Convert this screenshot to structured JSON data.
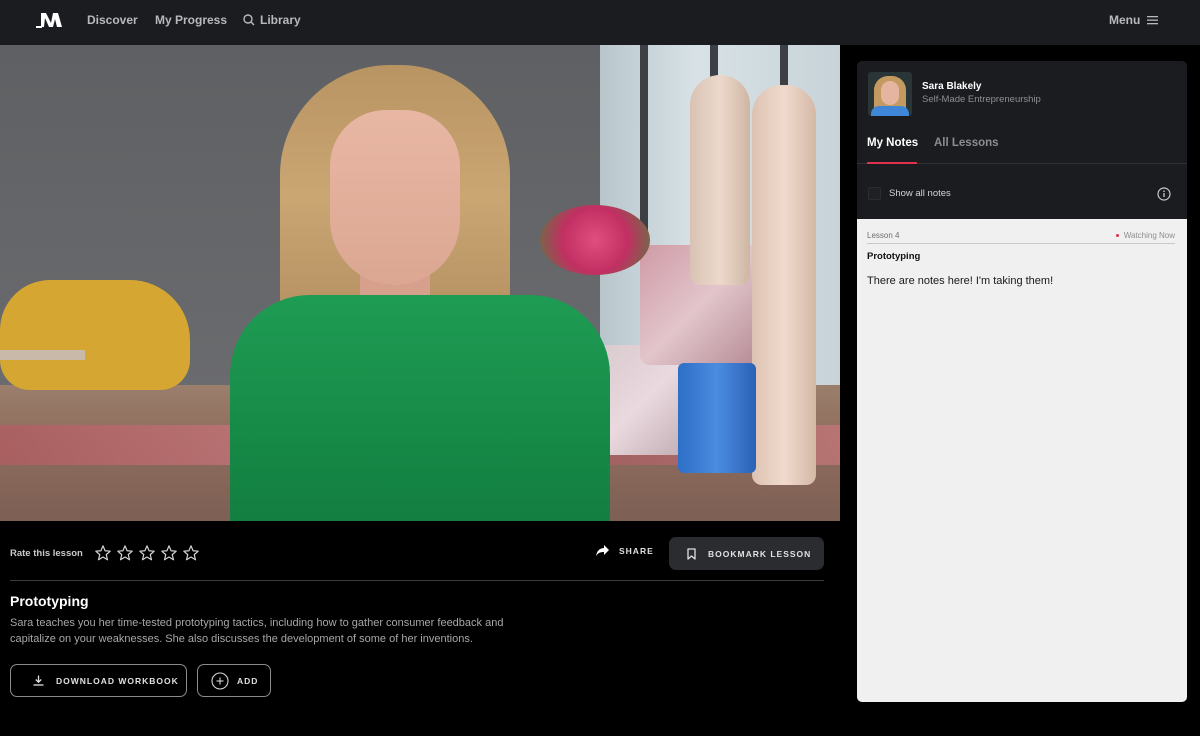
{
  "nav": {
    "logo": "MasterClass logo",
    "items": [
      {
        "label": "Discover"
      },
      {
        "label": "My Progress"
      },
      {
        "label": "Library",
        "icon": "search-icon"
      }
    ],
    "menu_label": "Menu",
    "menu_icon": "hamburger-icon"
  },
  "video": {
    "description": "Instructor speaking on set in green shirt"
  },
  "rating": {
    "label": "Rate this lesson",
    "max_stars": 5,
    "current": 0
  },
  "actions": {
    "share_label": "SHARE",
    "bookmark_label": "BOOKMARK LESSON"
  },
  "lesson": {
    "title": "Prototyping",
    "description": "Sara teaches you her time-tested prototyping tactics, including how to gather consumer feedback and capitalize on your weaknesses. She also discusses the development of some of her inventions.",
    "download_label": "DOWNLOAD WORKBOOK",
    "add_label": "ADD"
  },
  "panel": {
    "instructor_name": "Sara Blakely",
    "course_name": "Self-Made Entrepreneurship",
    "tabs": [
      {
        "label": "My Notes",
        "active": true
      },
      {
        "label": "All Lessons",
        "active": false
      }
    ],
    "show_all_label": "Show all notes",
    "show_all_checked": false,
    "note": {
      "lesson_number": "Lesson 4",
      "status": "Watching Now",
      "title": "Prototyping",
      "text": "There are notes here! I'm taking them!"
    }
  },
  "colors": {
    "accent": "#e0304e",
    "nav_bg": "#1b1c20",
    "panel_bg": "#1b1c20",
    "notes_bg": "#f0f0f0"
  }
}
